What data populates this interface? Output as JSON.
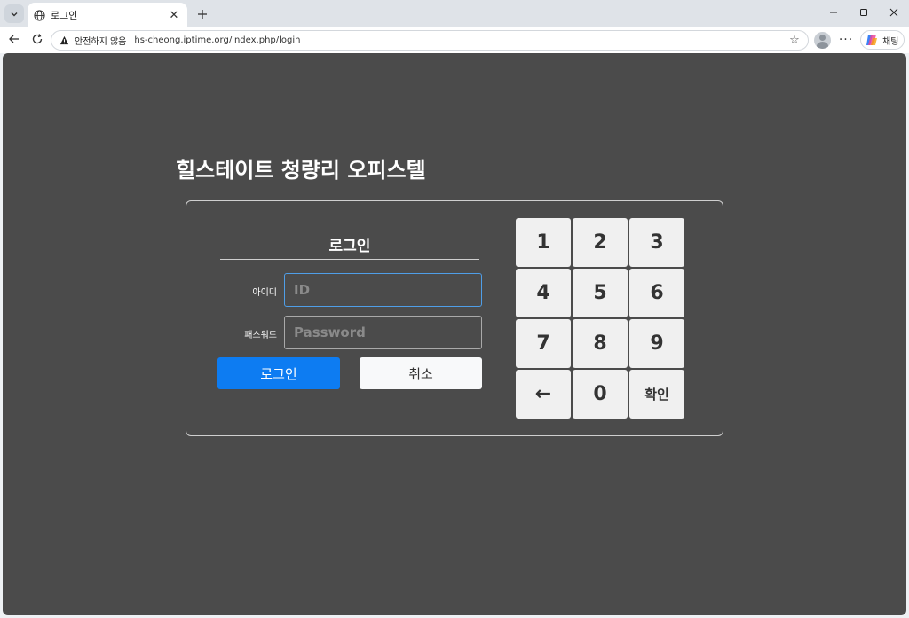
{
  "browser": {
    "tab_title": "로그인",
    "address": {
      "security_label": "안전하지 않음",
      "url": "hs-cheong.iptime.org/index.php/login"
    },
    "copilot_label": "채팅",
    "icons": {
      "tab_menu": "chevron-down-icon",
      "favicon": "globe-icon",
      "tab_close": "close-icon",
      "new_tab": "plus-icon",
      "back": "back-arrow-icon",
      "reload": "reload-icon",
      "warning": "warning-icon",
      "favorite": "star-icon",
      "profile": "avatar-icon",
      "more": "more-icon",
      "minimize": "minimize-icon",
      "maximize": "maximize-icon",
      "close": "close-icon"
    }
  },
  "page": {
    "site_title": "힐스테이트 청량리 오피스텔",
    "login": {
      "heading": "로그인",
      "id_label": "아이디",
      "id_placeholder": "ID",
      "pw_label": "패스워드",
      "pw_placeholder": "Password",
      "login_button": "로그인",
      "cancel_button": "취소"
    },
    "keypad": {
      "keys": [
        "1",
        "2",
        "3",
        "4",
        "5",
        "6",
        "7",
        "8",
        "9",
        "←",
        "0",
        "확인"
      ]
    },
    "colors": {
      "background": "#4b4b4b",
      "primary_button": "#0d7cf2",
      "focus_border": "#4f9ee8"
    }
  }
}
